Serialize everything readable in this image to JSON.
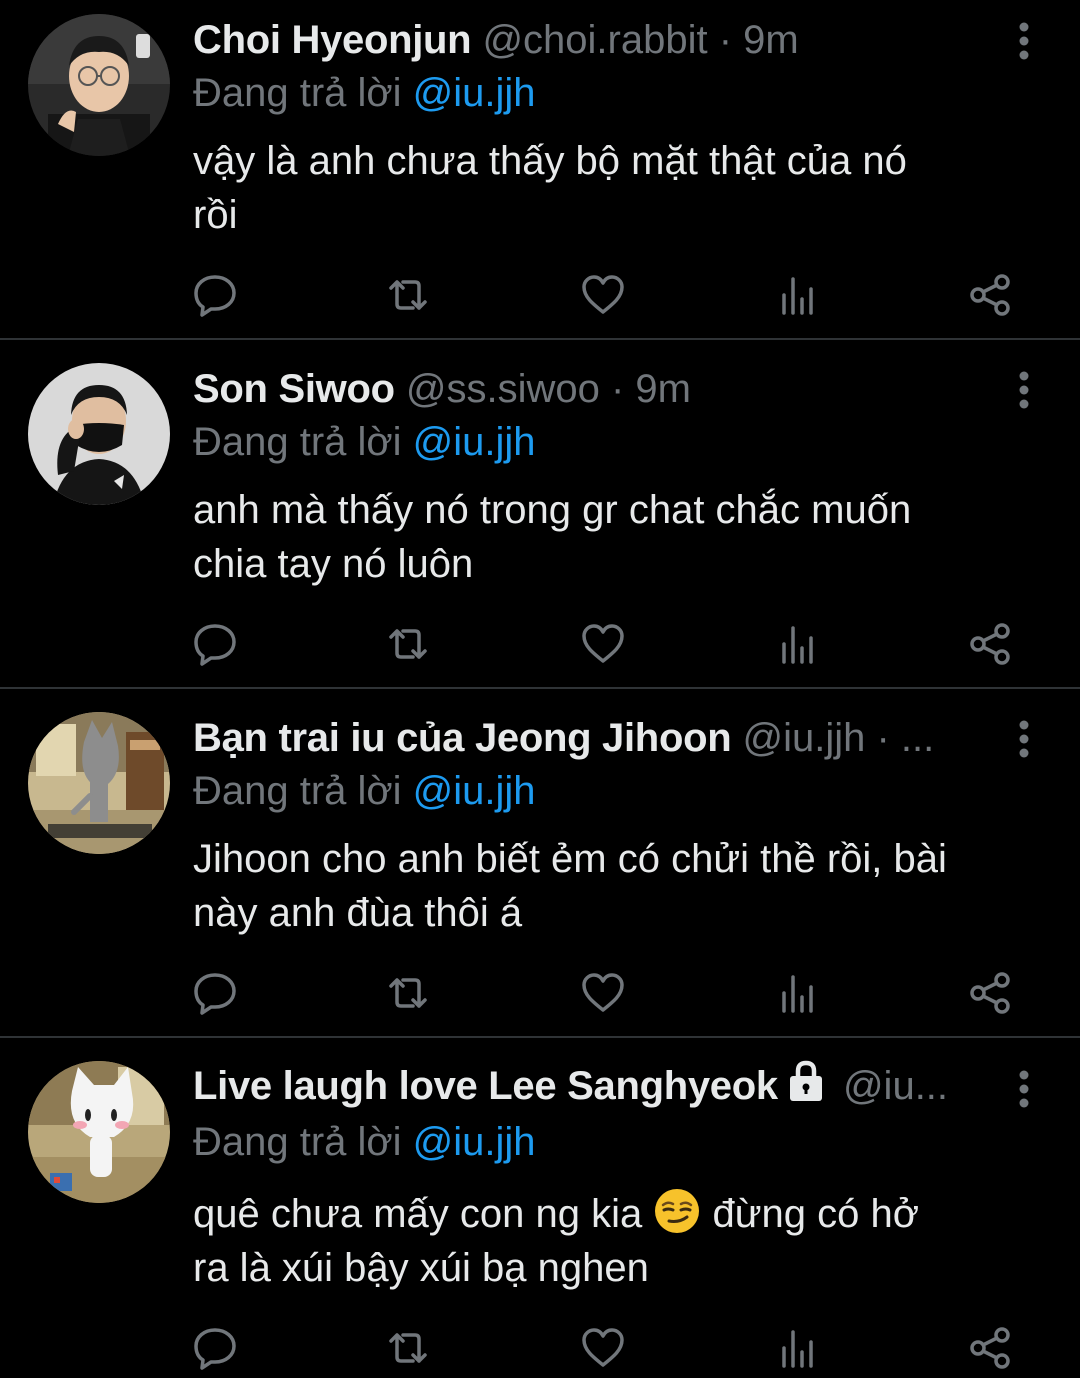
{
  "colors": {
    "background": "#000000",
    "text": "#e7e9ea",
    "muted": "#71767b",
    "link": "#1d9bf0",
    "divider": "#2f3336"
  },
  "tweets": [
    {
      "display_name": "Choi Hyeonjun",
      "handle": "@choi.rabbit",
      "dot": "·",
      "time": "9m",
      "reply_prefix": "Đang trả lời",
      "reply_to": "@iu.jjh",
      "body_lines": [
        "vậy là anh chưa thấy bộ mặt thật của nó",
        "rồi"
      ],
      "avatar_icon": "avatar-photo"
    },
    {
      "display_name": "Son Siwoo",
      "handle": "@ss.siwoo",
      "dot": "·",
      "time": "9m",
      "reply_prefix": "Đang trả lời",
      "reply_to": "@iu.jjh",
      "body_lines": [
        "anh mà thấy nó trong gr chat chắc muốn",
        "chia tay nó luôn"
      ],
      "avatar_icon": "avatar-photo"
    },
    {
      "display_name": "Bạn trai iu của Jeong Jihoon",
      "handle": "@iu.jjh",
      "dot": "·",
      "ellipsis": "...",
      "reply_prefix": "Đang trả lời",
      "reply_to": "@iu.jjh",
      "body_lines": [
        "Jihoon cho anh biết ẻm có chửi thề rồi, bài",
        "này anh đùa thôi á"
      ],
      "avatar_icon": "avatar-cartoon-cat"
    },
    {
      "display_name": "Live laugh love Lee Sanghyeok",
      "handle": "@iu...",
      "lock_icon": "lock-icon",
      "reply_prefix": "Đang trả lời",
      "reply_to": "@iu.jjh",
      "body_line1_before": "quê chưa mấy con ng kia ",
      "body_line1_after": " đừng có hở",
      "body_line2": "ra là xúi bậy xúi bạ nghen",
      "emoji_icon": "smirking-face-icon",
      "avatar_icon": "avatar-cartoon-cat"
    }
  ],
  "action_icons": [
    "reply-icon",
    "retweet-icon",
    "like-icon",
    "stats-icon",
    "share-icon"
  ]
}
